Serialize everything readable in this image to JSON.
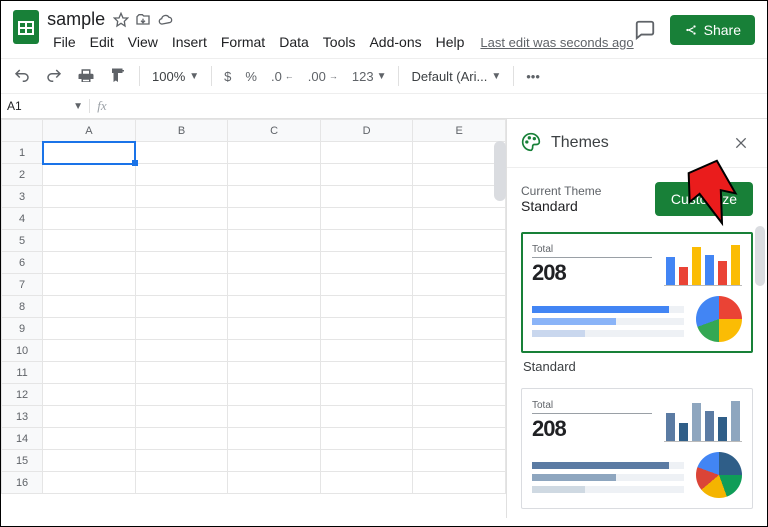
{
  "doc": {
    "title": "sample"
  },
  "menus": [
    "File",
    "Edit",
    "View",
    "Insert",
    "Format",
    "Data",
    "Tools",
    "Add-ons",
    "Help"
  ],
  "last_edit": "Last edit was seconds ago",
  "share_label": "Share",
  "toolbar": {
    "zoom": "100%",
    "currency": "$",
    "percent": "%",
    "dec_dec": ".0",
    "dec_inc": ".00",
    "numfmt": "123",
    "font": "Default (Ari...",
    "more": "•••"
  },
  "namebox": "A1",
  "formula": "",
  "columns": [
    "A",
    "B",
    "C",
    "D",
    "E"
  ],
  "rows": [
    "1",
    "2",
    "3",
    "4",
    "5",
    "6",
    "7",
    "8",
    "9",
    "10",
    "11",
    "12",
    "13",
    "14",
    "15",
    "16"
  ],
  "panel": {
    "title": "Themes",
    "current_label": "Current Theme",
    "current_value": "Standard",
    "customize_label": "Customize",
    "card_total_label": "Total",
    "card_total_value": "208",
    "theme1_name": "Standard"
  }
}
